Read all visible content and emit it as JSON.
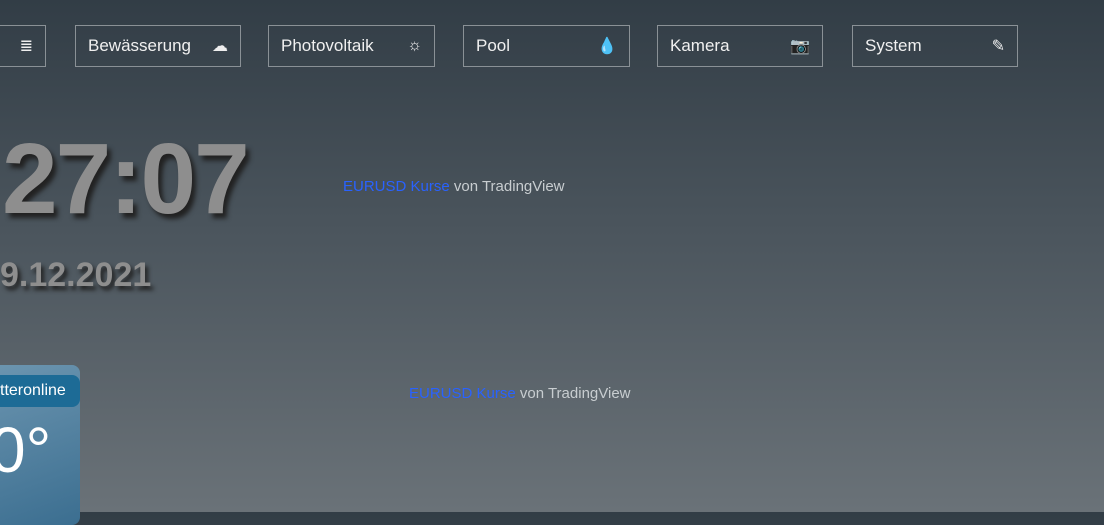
{
  "nav": [
    {
      "label": "",
      "icon": "menu-icon"
    },
    {
      "label": "Bewässerung",
      "icon": "rain-cloud-icon"
    },
    {
      "label": "Photovoltaik",
      "icon": "sun-icon"
    },
    {
      "label": "Pool",
      "icon": "water-drop-icon"
    },
    {
      "label": "Kamera",
      "icon": "camera-icon"
    },
    {
      "label": "System",
      "icon": "pencil-icon"
    }
  ],
  "clock": {
    "time": "27:07",
    "date": "9.12.2021"
  },
  "widgets": [
    {
      "link": "EURUSD Kurse",
      "suffix": " von TradingView"
    },
    {
      "link": "EURUSD Kurse",
      "suffix": " von TradingView"
    }
  ],
  "weather": {
    "brand": "tteronline",
    "temp": "0°"
  }
}
